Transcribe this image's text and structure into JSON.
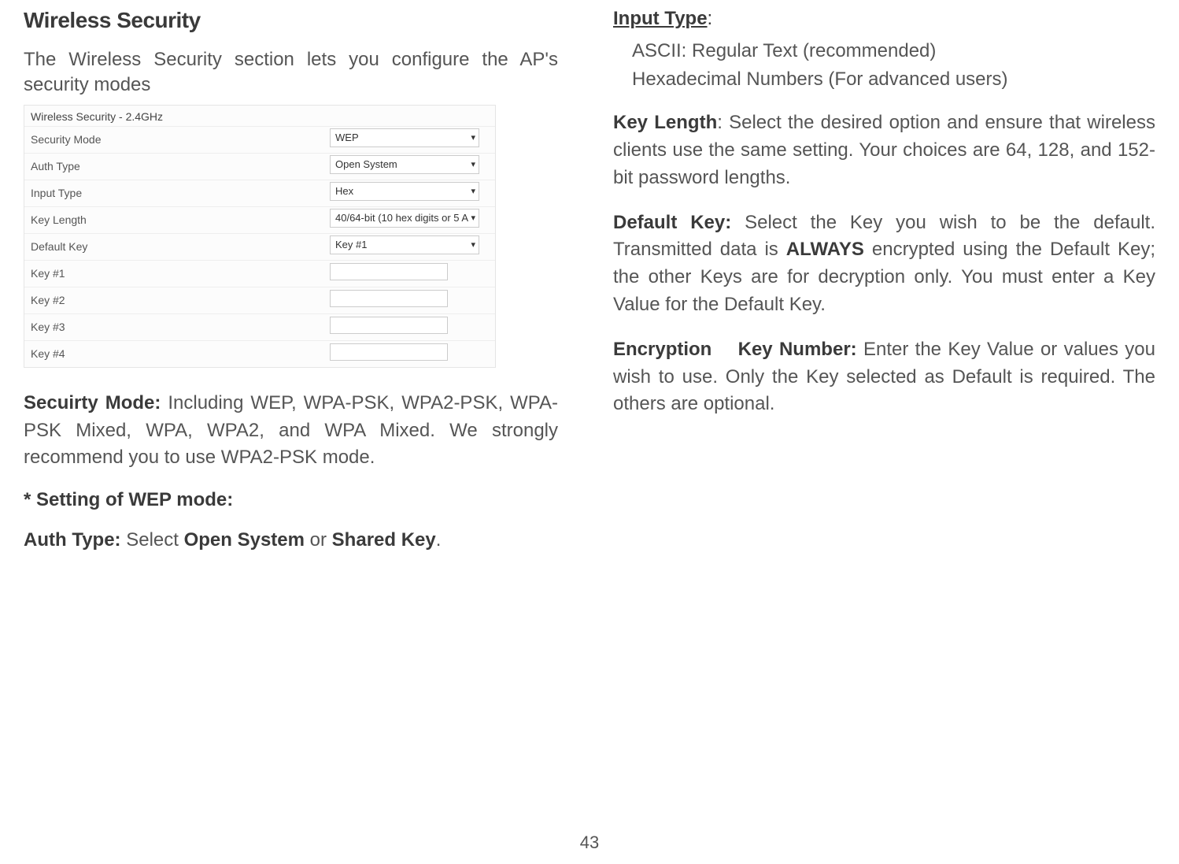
{
  "left": {
    "title": "Wireless Security",
    "intro": "The Wireless Security section lets you configure the AP's security modes",
    "screenshot": {
      "panel_title": "Wireless Security - 2.4GHz",
      "rows": {
        "security_mode": {
          "label": "Security Mode",
          "value": "WEP"
        },
        "auth_type": {
          "label": "Auth Type",
          "value": "Open System"
        },
        "input_type": {
          "label": "Input Type",
          "value": "Hex"
        },
        "key_length": {
          "label": "Key Length",
          "value": "40/64-bit (10 hex digits or 5 A"
        },
        "default_key": {
          "label": "Default Key",
          "value": "Key #1"
        },
        "key1": {
          "label": "Key #1"
        },
        "key2": {
          "label": "Key #2"
        },
        "key3": {
          "label": "Key #3"
        },
        "key4": {
          "label": "Key #4"
        }
      }
    },
    "security_mode_label": "Secuirty Mode:",
    "security_mode_text": " Including WEP, WPA-PSK, WPA2-PSK, WPA-PSK Mixed, WPA, WPA2, and WPA Mixed. We strongly recommend you to use WPA2-PSK mode.",
    "wep_heading": "* Setting of WEP mode:",
    "auth_type_label": "Auth Type:",
    "auth_type_text1": " Select ",
    "auth_type_bold1": "Open System",
    "auth_type_text2": " or ",
    "auth_type_bold2": "Shared Key",
    "auth_type_text3": "."
  },
  "right": {
    "input_type_label": "Input Type",
    "input_type_colon": ":",
    "input_type_line1": "ASCII: Regular Text (recommended)",
    "input_type_line2": "Hexadecimal Numbers (For advanced users)",
    "key_length_label": "Key Length",
    "key_length_text": ": Select the desired option and ensure that wireless clients use the same setting. Your choices are 64, 128, and 152-bit password lengths.",
    "default_key_label": "Default Key:",
    "default_key_text1": " Select the Key you wish to be the default. Transmitted data is ",
    "default_key_bold": "ALWAYS",
    "default_key_text2": " encrypted using the Default Key; the other Keys are for decryption only. You must enter a Key Value for the Default Key.",
    "encryption_label": "Encryption    Key Number:",
    "encryption_text": " Enter the Key Value or values you wish to use. Only the Key selected as Default is required. The others are optional."
  },
  "page_number": "43"
}
